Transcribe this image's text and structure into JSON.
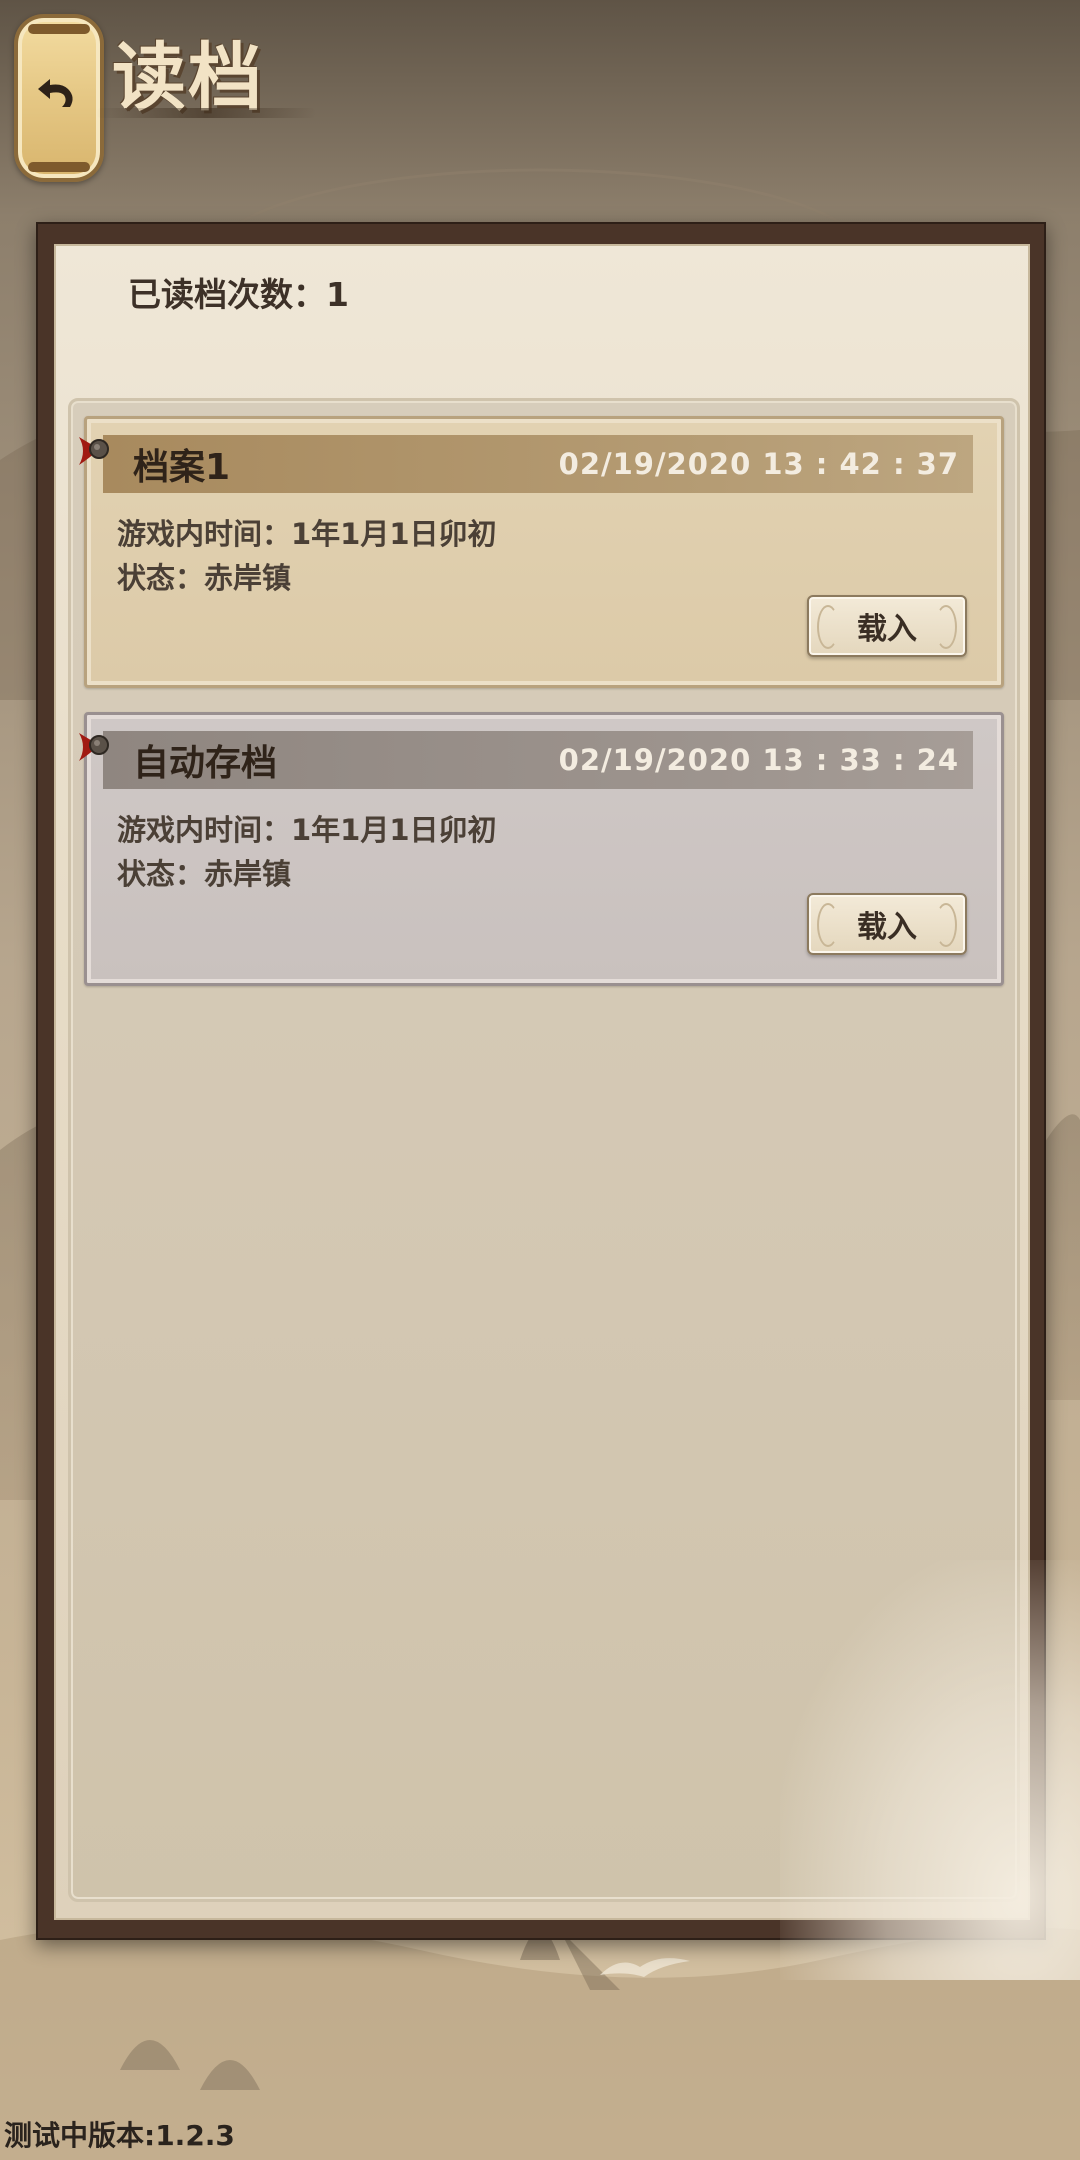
{
  "header": {
    "title": "读档",
    "back_icon": "back-arrow-icon"
  },
  "panel": {
    "read_count_text": "已读档次数：1"
  },
  "saves": [
    {
      "title": "档案1",
      "timestamp": "02/19/2020  13 : 42 : 37",
      "game_time": "游戏内时间：1年1月1日卯初",
      "status": "状态：赤岸镇",
      "load_label": "载入"
    },
    {
      "title": "自动存档",
      "timestamp": "02/19/2020  13 : 33 : 24",
      "game_time": "游戏内时间：1年1月1日卯初",
      "status": "状态：赤岸镇",
      "load_label": "载入"
    }
  ],
  "footer": {
    "version": "测试中版本:1.2.3"
  },
  "colors": {
    "manual_header": "#a88a5e",
    "auto_header": "#8f8680",
    "pin_red": "#a11a12",
    "panel_frame": "#4a3428"
  }
}
